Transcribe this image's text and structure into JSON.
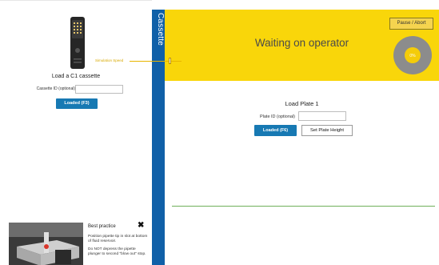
{
  "left_panel": {
    "load_label": "Load a C1 cassette",
    "cassette_id_label": "Cassette ID (optional)",
    "cassette_id_value": "",
    "loaded_button": "Loaded (F3)"
  },
  "best_practice": {
    "title": "Best practice",
    "close_glyph": "✖",
    "line1": "Position pipette tip in slot at bottom of fluid reservoir.",
    "line2": "Do NOT depress the pipette plunger to second \"blow out\" stop."
  },
  "tab": {
    "label": "Cassette"
  },
  "header": {
    "status": "Waiting on operator",
    "speed_label": "Simulation Speed",
    "speed_level": 0.78,
    "pause_button": "Pause / Abort",
    "progress_text": "0%",
    "progress_value": 0
  },
  "plate": {
    "title": "Load Plate 1",
    "plate_id_label": "Plate ID (optional)",
    "plate_id_value": "",
    "loaded_button": "Loaded (F6)",
    "set_height_button": "Set Plate Height"
  },
  "colors": {
    "accent_blue": "#1779b3",
    "tab_blue": "#1060a8",
    "header_yellow": "#f9d60a",
    "progress_gray": "#8c8c8c",
    "progress_center": "#f4cc0a",
    "divider_green": "#6fb05a"
  },
  "icons": {
    "cassette_device": "cassette-device-icon",
    "pipette_photo": "pipette-photo",
    "close": "close-icon",
    "progress_ring": "progress-ring-icon"
  }
}
